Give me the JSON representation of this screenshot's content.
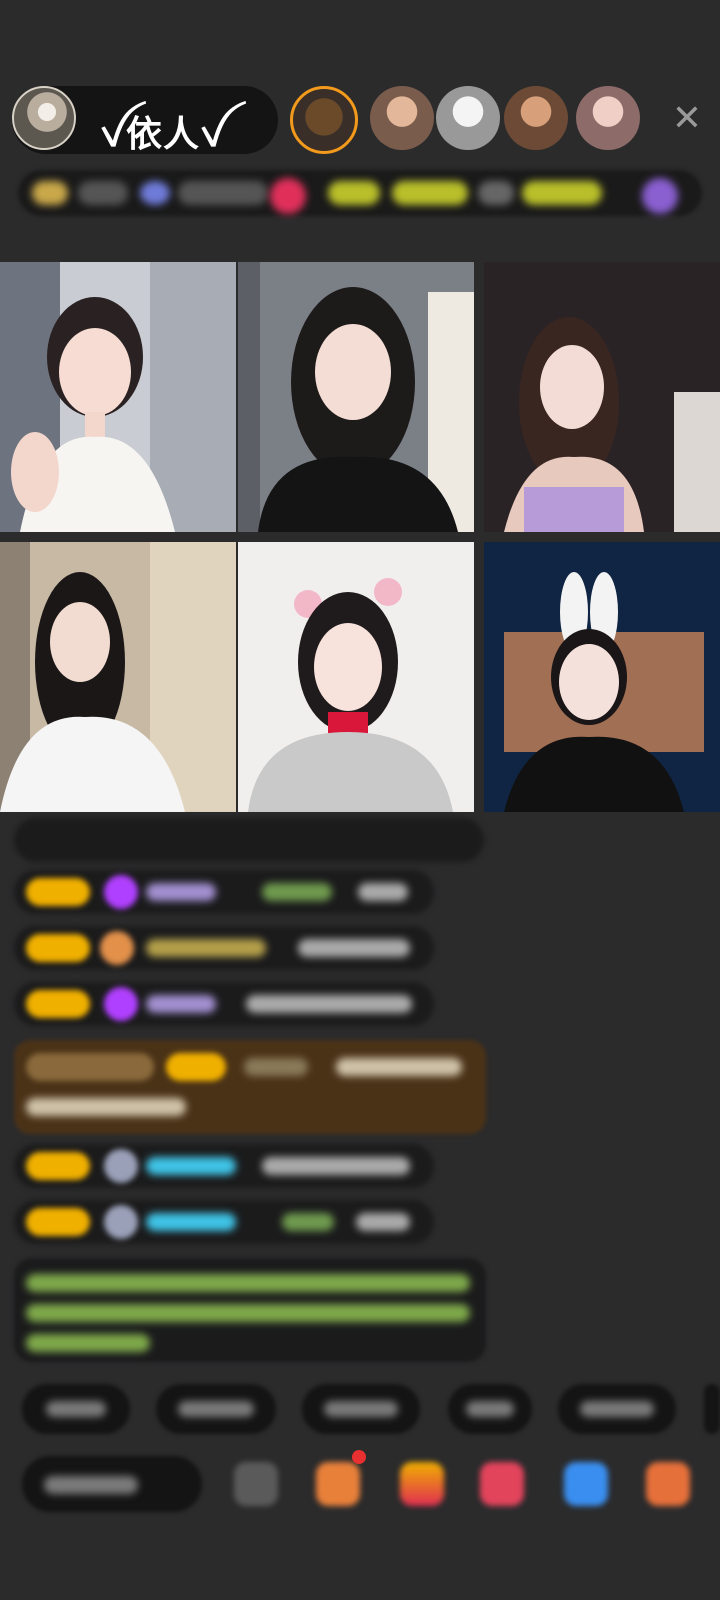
{
  "host": {
    "name": "ꪜ依人ꪜ"
  },
  "colors": {
    "background": "#2b2b2c",
    "pill": "#141414",
    "badge_yellow": "#f0b000",
    "gift_purple": "#b040ff",
    "chat_green": "#9ccf57",
    "chat_cyan": "#3fc3e6",
    "highlight_brown": "#4a3217"
  },
  "video_grid": {
    "cells": [
      {
        "label": "guest-1"
      },
      {
        "label": "guest-2"
      },
      {
        "label": "guest-3"
      },
      {
        "label": "guest-4"
      },
      {
        "label": "guest-5"
      },
      {
        "label": "guest-6"
      }
    ]
  },
  "icons": {
    "close": "close-icon",
    "gift": "gift-icon",
    "more": "more-icon"
  }
}
